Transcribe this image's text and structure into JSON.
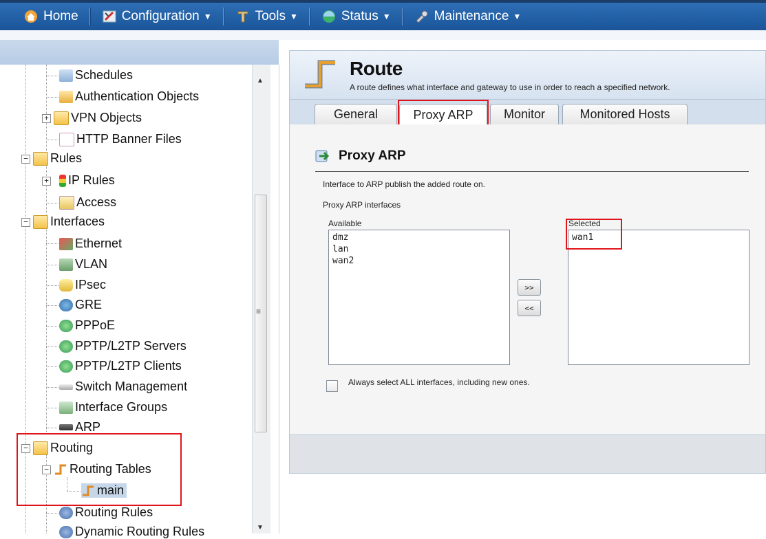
{
  "nav": {
    "home": "Home",
    "configuration": "Configuration",
    "tools": "Tools",
    "status": "Status",
    "maintenance": "Maintenance"
  },
  "tree": {
    "schedules": "Schedules",
    "authentication_objects": "Authentication Objects",
    "vpn_objects": "VPN Objects",
    "http_banner_files": "HTTP Banner Files",
    "rules": "Rules",
    "ip_rules": "IP Rules",
    "access": "Access",
    "interfaces": "Interfaces",
    "ethernet": "Ethernet",
    "vlan": "VLAN",
    "ipsec": "IPsec",
    "gre": "GRE",
    "pppoe": "PPPoE",
    "pptp_servers": "PPTP/L2TP Servers",
    "pptp_clients": "PPTP/L2TP Clients",
    "switch_management": "Switch Management",
    "interface_groups": "Interface Groups",
    "arp": "ARP",
    "routing": "Routing",
    "routing_tables": "Routing Tables",
    "main": "main",
    "routing_rules": "Routing Rules",
    "dynamic_routing_rules": "Dynamic Routing Rules"
  },
  "route": {
    "title": "Route",
    "description": "A route defines what interface and gateway to use in order to reach a specified network."
  },
  "tabs": [
    "General",
    "Proxy ARP",
    "Monitor",
    "Monitored Hosts"
  ],
  "proxy_arp": {
    "section_title": "Proxy ARP",
    "help_text": "Interface to ARP publish the added route on.",
    "interfaces_label": "Proxy ARP interfaces",
    "available_label": "Available",
    "selected_label": "Selected",
    "available": [
      "dmz",
      "lan",
      "wan2"
    ],
    "selected": [
      "wan1"
    ],
    "add_button": ">>",
    "remove_button": "<<",
    "select_all_label": "Always select ALL interfaces, including new ones."
  },
  "colors": {
    "nav_bar": "#205da3",
    "highlight": "#e0151b"
  }
}
